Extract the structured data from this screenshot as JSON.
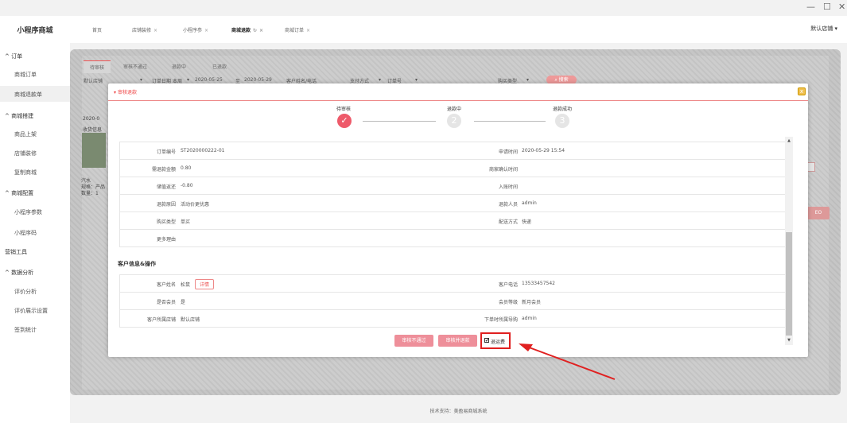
{
  "window": {
    "minimize": "—",
    "maximize": "☐",
    "close": "✕"
  },
  "brand": "小程序商城",
  "sidebar": {
    "groups": [
      {
        "label": "^ 订单",
        "items": [
          "商城订单",
          "商城退款单"
        ]
      },
      {
        "label": "^ 商城搭建",
        "items": [
          "商品上架",
          "店铺装修",
          "复制商城"
        ]
      },
      {
        "label": "^ 商城配置",
        "items": [
          "小程序参数",
          "小程序码"
        ]
      },
      {
        "label": "营销工具",
        "items": []
      },
      {
        "label": "^ 数据分析",
        "items": [
          "评价分析",
          "评价展示设置",
          "签到统计"
        ]
      }
    ],
    "active_item": "商城退款单"
  },
  "topbar": {
    "tabs": [
      "首页",
      "店铺装修",
      "小程序参",
      "商城退款",
      "商城订单"
    ],
    "current_tab": "商城退款",
    "store_select": "默认店铺"
  },
  "background": {
    "subtabs": [
      "待审核",
      "审核不通过",
      "退款中",
      "已退款"
    ],
    "filter_store": "默认店铺",
    "filter_date_label": "订单日期",
    "filter_period": "本周",
    "date_from": "2020-05-25",
    "date_sep": "至",
    "date_to": "2020-05-29",
    "customer_placeholder": "客户姓名/电话",
    "pay_method": "支付方式",
    "order_no": "订单号",
    "buy_type": "购买类型",
    "search": "搜索",
    "card_date": "2020-0",
    "card_receive": "收货信息",
    "card_name": "汽水",
    "card_spec": "规格：产品",
    "card_qty": "数量：1",
    "side_btn": "EO"
  },
  "modal": {
    "title": "审核退款",
    "close": "x",
    "steps": [
      {
        "label": "待审核",
        "mark": "✓"
      },
      {
        "label": "退款中",
        "mark": "2"
      },
      {
        "label": "退款成功",
        "mark": "3"
      }
    ],
    "order_rows": [
      {
        "l1": "订单编号",
        "v1": "ST2020000222-01",
        "l2": "申请时间",
        "v2": "2020-05-29 15:54"
      },
      {
        "l1": "需退款金额",
        "v1": "0.80",
        "l2": "商家确认时间",
        "v2": ""
      },
      {
        "l1": "储值返还",
        "v1": "-0.80",
        "l2": "入账时间",
        "v2": ""
      },
      {
        "l1": "退款原因",
        "v1": "活动价更优惠",
        "l2": "退款人员",
        "v2": "admin"
      },
      {
        "l1": "购买类型",
        "v1": "单买",
        "l2": "配送方式",
        "v2": "快递"
      },
      {
        "l1": "更多理由",
        "v1": "",
        "l2": "",
        "v2": ""
      }
    ],
    "customer_section": "客户信息&操作",
    "customer_rows": [
      {
        "l1": "客户姓名",
        "v1": "松鼠",
        "tag": "详情",
        "l2": "客户电话",
        "v2": "13533457542"
      },
      {
        "l1": "是否会员",
        "v1": "是",
        "tag": "",
        "l2": "会员等级",
        "v2": "新月会员"
      },
      {
        "l1": "客户所属店铺",
        "v1": "默认店铺",
        "tag": "",
        "l2": "下单时所属导购",
        "v2": "admin"
      }
    ],
    "btn_reject": "审核不通过",
    "btn_approve": "审核并退款",
    "freight_label": "退运费",
    "freight_checked": "✔"
  },
  "footer": "技术支持：美盈易商城系统"
}
